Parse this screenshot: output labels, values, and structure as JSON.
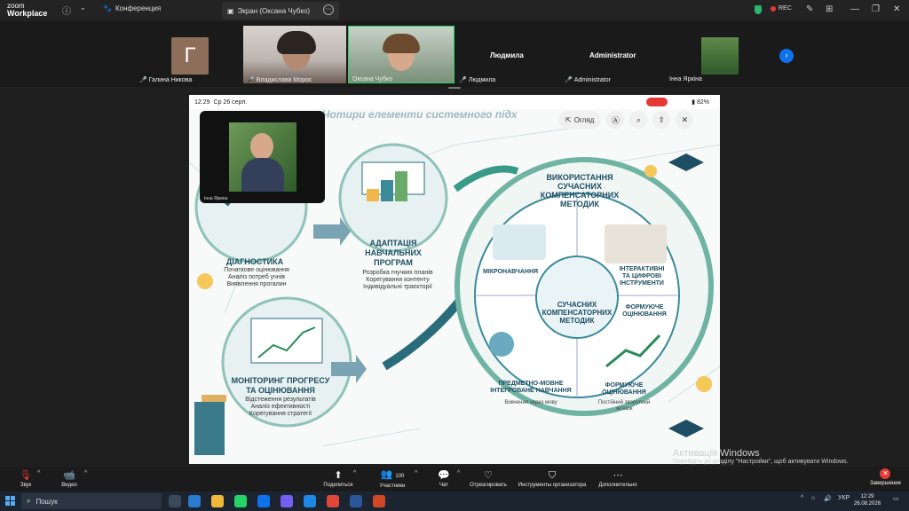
{
  "app": {
    "logo_line1": "zoom",
    "logo_line2": "Workplace"
  },
  "topbar": {
    "meeting_label": "Конференция",
    "share_tab_label": "Экран (Оксана Чубко)",
    "rec_label": "REC"
  },
  "participants": [
    {
      "initial": "Г",
      "name": "Галина Никова"
    },
    {
      "name": "Владислава Морос"
    },
    {
      "name": "Оксана Чубко"
    },
    {
      "display": "Людмила",
      "name": "Людмила"
    },
    {
      "display": "Administrator",
      "name": "Administrator"
    },
    {
      "name": "Інна Яркіна"
    }
  ],
  "shared": {
    "status_time": "12:29",
    "status_date": "Ср 26 серп.",
    "battery": "82%",
    "overview_label": "Огляд",
    "header_text": "Чотири елементи системного підх",
    "float_label": "Інна Яркіна",
    "blocks": {
      "diag_title": "ДІАГНОСТИКА",
      "diag_l1": "Початкове оцінювання",
      "diag_l2": "Аналіз потреб учнів",
      "diag_l3": "Виявлення прогалин",
      "adapt_title1": "АДАПТАЦІЯ",
      "adapt_title2": "НАВЧАЛЬНИХ",
      "adapt_title3": "ПРОГРАМ",
      "adapt_l1": "Розробка гнучких планів",
      "adapt_l2": "Корегування контенту",
      "adapt_l3": "Індивідуальні траєкторії",
      "mon_title1": "МОНІТОРИНГ ПРОГРЕСУ",
      "mon_title2": "ТА ОЦІНЮВАННЯ",
      "mon_l1": "Відстеження результатів",
      "mon_l2": "Аналіз ефективності",
      "mon_l3": "Корегування стратегії",
      "use_title1": "ВИКОРИСТАННЯ",
      "use_title2": "СУЧАСНИХ",
      "use_title3": "КОМПЕНСАТОРНИХ",
      "use_title4": "МЕТОДИК",
      "micro": "МІКРОНАВЧАННЯ",
      "inter1": "ІНТЕРАКТИВНІ",
      "inter2": "ТА ЦИФРОВІ",
      "inter3": "ІНСТРУМЕНТИ",
      "form1": "ФОРМУЮЧЕ",
      "form2": "ОЦІНЮВАННЯ",
      "center1": "СУЧАСНИХ",
      "center2": "КОМПЕНСАТОРНИХ",
      "center3": "МЕТОДИК",
      "clil1": "ПРЕДМЕТНО-МОВНЕ",
      "clil2": "ІНТЕГРОВАНЕ НАВЧАННЯ",
      "clil_sub": "Вивчення через мову",
      "form3": "ФОРМУЮЧЕ",
      "form4": "ОЦІНЮВАННЯ",
      "form_sub1": "Постійний зворотний",
      "form_sub2": "зв'язок"
    }
  },
  "watermark": {
    "line1": "Активація Windows",
    "line2": "Перейдіть до розділу \"Настройки\", щоб активувати Windows."
  },
  "toolbar": {
    "audio": "Звук",
    "video": "Видео",
    "share": "Поделиться",
    "participants": "Участники",
    "participants_count": "100",
    "chat": "Чат",
    "react": "Отреагировать",
    "host_tools": "Инструменты организатора",
    "more": "Дополнительно",
    "end": "Завершение"
  },
  "taskbar": {
    "search_placeholder": "Пошук",
    "lang": "УКР",
    "time": "12:29",
    "date": "26.08.2026"
  }
}
